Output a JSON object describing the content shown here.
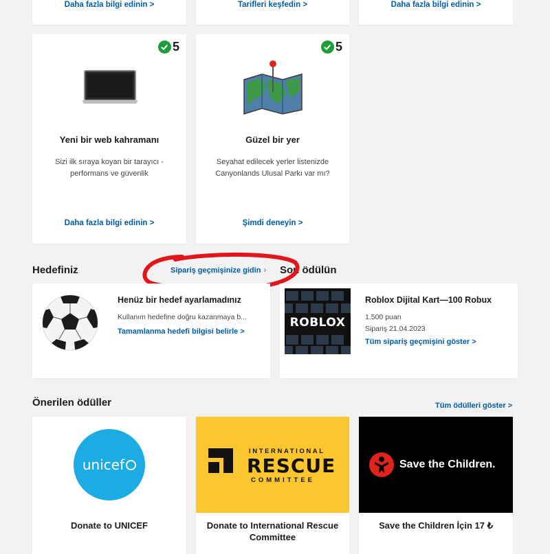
{
  "top_row": {
    "links": [
      "Daha fazla bilgi edinin >",
      "Tarifleri keşfedin >",
      "Daha fazla bilgi edinin >"
    ]
  },
  "activity_cards": [
    {
      "badge": "5",
      "title": "Yeni bir web kahramanı",
      "desc": "Sizi ilk sıraya koyan bir tarayıcı - performans ve güvenlik",
      "link": "Daha fazla bilgi edinin >",
      "icon": "laptop-icon"
    },
    {
      "badge": "5",
      "title": "Güzel bir yer",
      "desc": "Seyahat edilecek yerler listenizde Canyonlands Ulusal Parkı var mı?",
      "link": "Şimdi deneyin >",
      "icon": "map-pin-icon"
    }
  ],
  "goal": {
    "section_title": "Hedefiniz",
    "order_history_link": "Sipariş geçmişinize gidin",
    "title": "Henüz bir hedef ayarlamadınız",
    "desc": "Kullanım hedefine doğru kazanmaya b...",
    "link": "Tamamlanma hedefi bilgisi belirle >",
    "icon": "soccer-ball-icon"
  },
  "last_reward": {
    "section_title": "Son ödülün",
    "title": "Roblox Dijital Kart—100 Robux",
    "points": "1.500 puan",
    "order_date": "Sipariş 21.04.2023",
    "link": "Tüm sipariş geçmişini göster >",
    "image_text": "ROBLOX"
  },
  "recommended": {
    "section_title": "Önerilen ödüller",
    "show_all": "Tüm ödülleri göster >",
    "items": [
      {
        "title": "Donate to UNICEF",
        "logo_text": "unicef"
      },
      {
        "title": "Donate to International Rescue Committee",
        "logo_lines": [
          "INTERNATIONAL",
          "RESCUE",
          "COMMITTEE"
        ]
      },
      {
        "title": "Save the Children İçin 17 ₺",
        "logo_text": "Save the Children."
      }
    ]
  },
  "colors": {
    "link": "#005da6",
    "check": "#1e9e3a",
    "unicef": "#1cabe2",
    "irc": "#fdc52e",
    "stc_bg": "#000000",
    "stc_red": "#e2231a",
    "annotation": "#e3151a"
  }
}
